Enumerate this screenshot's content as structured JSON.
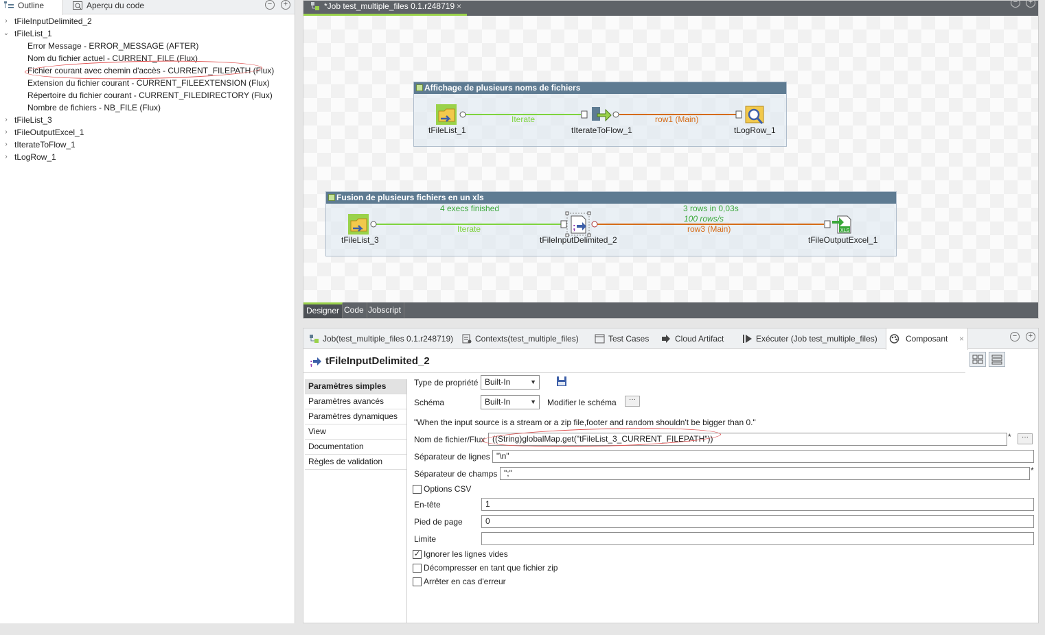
{
  "outline": {
    "tabs": [
      {
        "label": "Outline",
        "icon": "outline-icon"
      },
      {
        "label": "Aperçu du code",
        "icon": "code-preview-icon"
      }
    ],
    "tree": [
      {
        "label": "tFileInputDelimited_2",
        "expanded": false
      },
      {
        "label": "tFileList_1",
        "expanded": true,
        "children": [
          "Error Message - ERROR_MESSAGE (AFTER)",
          "Nom du fichier actuel - CURRENT_FILE (Flux)",
          "Fichier courant avec chemin d'accès - CURRENT_FILEPATH (Flux)",
          "Extension du fichier courant - CURRENT_FILEEXTENSION (Flux)",
          "Répertoire du fichier courant - CURRENT_FILEDIRECTORY (Flux)",
          "Nombre de fichiers - NB_FILE (Flux)"
        ]
      },
      {
        "label": "tFileList_3",
        "expanded": false
      },
      {
        "label": "tFileOutputExcel_1",
        "expanded": false
      },
      {
        "label": "tIterateToFlow_1",
        "expanded": false
      },
      {
        "label": "tLogRow_1",
        "expanded": false
      }
    ]
  },
  "editor": {
    "tab_title": "*Job test_multiple_files 0.1.r248719",
    "subjob1": {
      "title": "Affichage de plusieurs noms de fichiers",
      "components": [
        "tFileList_1",
        "tIterateToFlow_1",
        "tLogRow_1"
      ],
      "links": [
        "Iterate",
        "row1 (Main)"
      ]
    },
    "subjob2": {
      "title": "Fusion de plusieurs fichiers en un xls",
      "components": [
        "tFileList_3",
        "tFileInputDelimited_2",
        "tFileOutputExcel_1"
      ],
      "links": [
        "Iterate",
        "row3 (Main)"
      ],
      "stats": [
        "4 execs finished",
        "3 rows in 0,03s",
        "100 rows/s"
      ]
    },
    "bottom_tabs": [
      "Designer",
      "Code",
      "Jobscript"
    ],
    "colors": {
      "iterate": "#7ed33d",
      "main": "#d56b16",
      "subjob_header": "#5e7b92",
      "tab_accent": "#9ad24a"
    }
  },
  "props": {
    "tabs": [
      {
        "label": "Job(test_multiple_files 0.1.r248719)",
        "icon": "job-icon"
      },
      {
        "label": "Contexts(test_multiple_files)",
        "icon": "contexts-icon"
      },
      {
        "label": "Test Cases",
        "icon": "test-cases-icon"
      },
      {
        "label": "Cloud Artifact",
        "icon": "cloud-artifact-icon"
      },
      {
        "label": "Exécuter (Job test_multiple_files)",
        "icon": "run-icon"
      },
      {
        "label": "Composant",
        "icon": "component-icon"
      }
    ],
    "component_title": "tFileInputDelimited_2",
    "nav": [
      "Paramètres simples",
      "Paramètres avancés",
      "Paramètres dynamiques",
      "View",
      "Documentation",
      "Règles de validation"
    ],
    "fields": {
      "type_label": "Type de propriété",
      "type_value": "Built-In",
      "schema_label": "Schéma",
      "schema_value": "Built-In",
      "edit_schema": "Modifier le schéma",
      "note": "\"When the input source is a stream or a zip file,footer and random shouldn't be bigger than 0.\"",
      "filename_label": "Nom de fichier/Flux",
      "filename_value": "((String)globalMap.get(\"tFileList_3_CURRENT_FILEPATH\"))",
      "row_sep_label": "Séparateur de lignes",
      "row_sep_value": "\"\\n\"",
      "field_sep_label": "Séparateur de champs",
      "field_sep_value": "\";\"",
      "csv_label": "Options CSV",
      "header_label": "En-tête",
      "header_value": "1",
      "footer_label": "Pied de page",
      "footer_value": "0",
      "limit_label": "Limite",
      "limit_value": "",
      "skip_empty_label": "Ignorer les lignes vides",
      "uncompress_label": "Décompresser en tant que fichier zip",
      "die_on_error_label": "Arrêter en cas d'erreur"
    }
  }
}
